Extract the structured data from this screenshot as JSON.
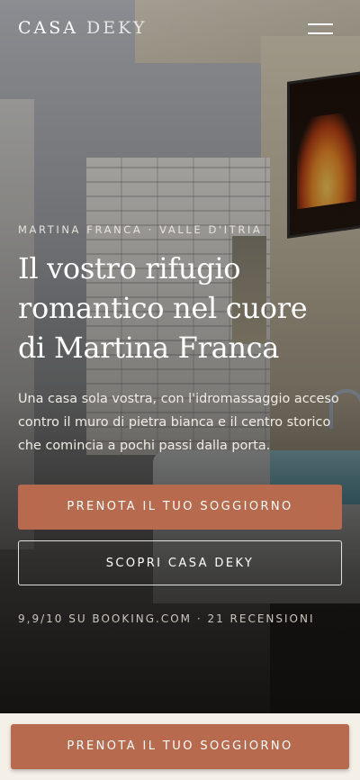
{
  "header": {
    "brand_first": "CASA",
    "brand_second": "DEKY",
    "menu_icon": "hamburger-icon"
  },
  "hero": {
    "eyebrow": "MARTINA FRANCA · VALLE D'ITRIA",
    "headline": "Il vostro rifugio romantico nel cuore di Martina Franca",
    "lead": "Una casa sola vostra, con l'idromassaggio acceso contro il muro di pietra bianca e il centro storico che comincia a pochi passi dalla porta.",
    "primary_cta": "PRENOTA IL TUO SOGGIORNO",
    "secondary_cta": "SCOPRI CASA DEKY",
    "rating": "9,9/10 SU BOOKING.COM · 21 RECENSIONI"
  },
  "sticky_bar": {
    "cta": "PRENOTA IL TUO SOGGIORNO"
  },
  "colors": {
    "accent": "#b86a4e",
    "sticky_bg": "#f4efe7"
  }
}
